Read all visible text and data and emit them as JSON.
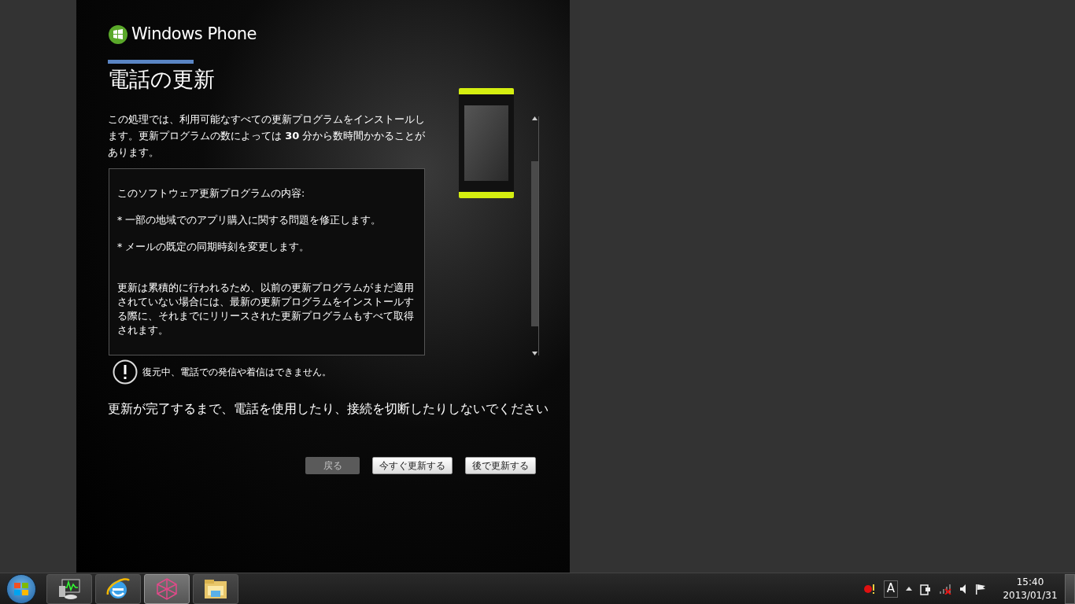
{
  "dialog": {
    "logo_text": "Windows Phone",
    "title": "電話の更新",
    "intro": "この処理では、利用可能なすべての更新プログラムをインストールします。更新プログラムの数によっては **30** 分から数時間かかることがあります。",
    "details": [
      {
        "kind": "heading",
        "text": "このソフトウェア更新プログラムの内容:"
      },
      {
        "kind": "bullet",
        "text": "* 一部の地域でのアプリ購入に関する問題を修正します。"
      },
      {
        "kind": "bullet",
        "text": "* メールの既定の同期時刻を変更します。"
      },
      {
        "kind": "note",
        "text": "更新は累積的に行われるため、以前の更新プログラムがまだ適用されていない場合には、最新の更新プログラムをインストールする際に、それまでにリリースされた更新プログラムもすべて取得されます。"
      }
    ],
    "warning": "復元中、電話での発信や着信はできません。",
    "instruction": "更新が完了するまで、電話を使用したり、接続を切断したりしないでください",
    "buttons": [
      {
        "label": "戻る",
        "disabled": true
      },
      {
        "label": "今すぐ更新する",
        "disabled": false
      },
      {
        "label": "後で更新する",
        "disabled": false
      }
    ]
  },
  "taskbar": {
    "apps": [
      {
        "kind": "monitor",
        "selected": false
      },
      {
        "kind": "browser",
        "selected": false
      },
      {
        "kind": "zune",
        "selected": true
      },
      {
        "kind": "folder",
        "selected": false
      }
    ],
    "clock": {
      "time": "15:40",
      "date": "2013/01/31"
    },
    "ime": "A"
  }
}
